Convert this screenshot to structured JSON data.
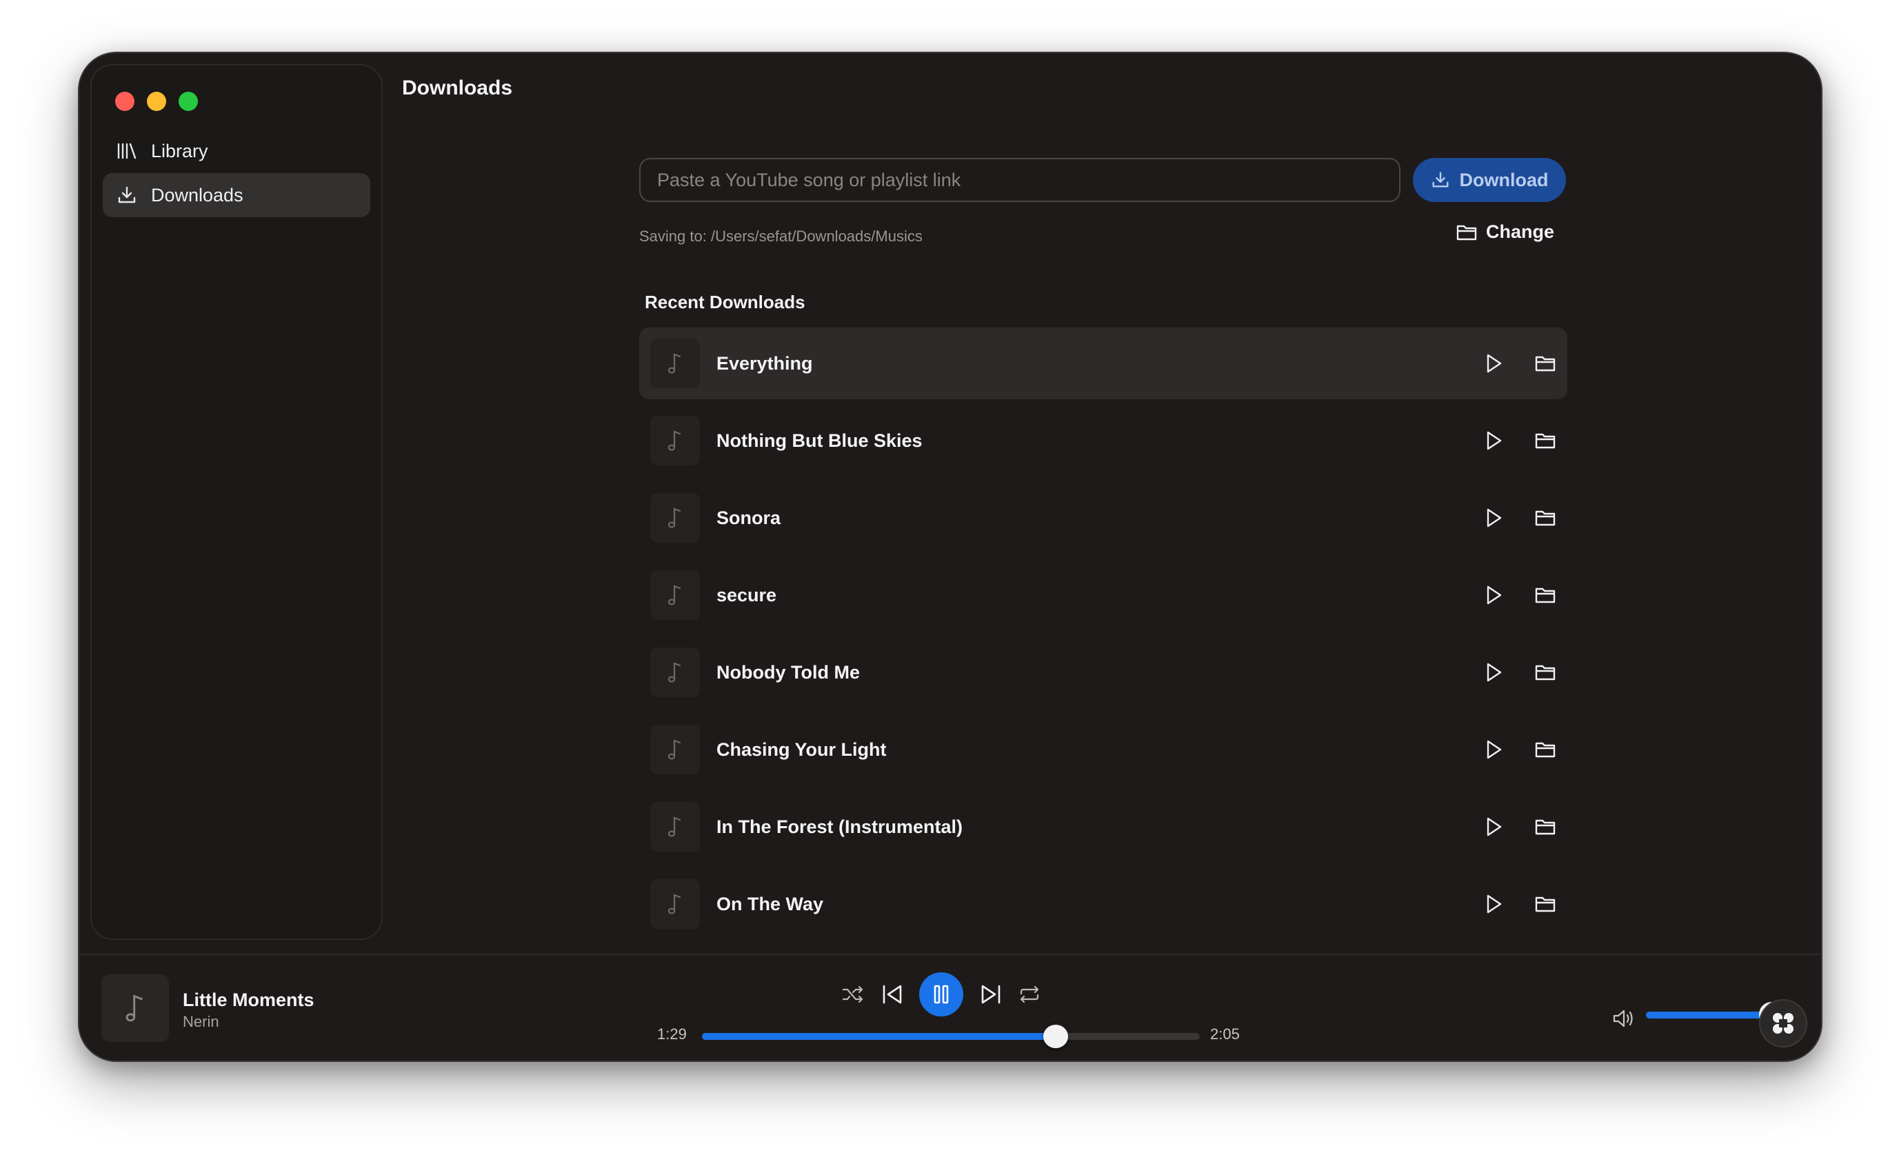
{
  "window": {
    "traffic_lights": [
      "#ff5f57",
      "#febc2e",
      "#28c840"
    ]
  },
  "sidebar": {
    "items": [
      {
        "label": "Library",
        "icon": "library-icon",
        "active": false
      },
      {
        "label": "Downloads",
        "icon": "download-icon",
        "active": true
      }
    ]
  },
  "page": {
    "title": "Downloads"
  },
  "download_form": {
    "url_value": "",
    "url_placeholder": "Paste a YouTube song or playlist link",
    "download_label": "Download",
    "saving_to": "Saving to: /Users/sefat/Downloads/Musics",
    "change_label": "Change"
  },
  "recent": {
    "title": "Recent Downloads",
    "items": [
      {
        "title": "Everything"
      },
      {
        "title": "Nothing But Blue Skies"
      },
      {
        "title": "Sonora"
      },
      {
        "title": "secure"
      },
      {
        "title": "Nobody Told Me"
      },
      {
        "title": "Chasing Your Light"
      },
      {
        "title": "In The Forest (Instrumental)"
      },
      {
        "title": "On The Way"
      }
    ]
  },
  "player": {
    "title": "Little Moments",
    "artist": "Nerin",
    "elapsed": "1:29",
    "duration": "2:05",
    "progress": 0.71,
    "volume": 0.95,
    "state": "playing"
  },
  "colors": {
    "accent": "#1a73e8",
    "download_button": "#1c4b99",
    "background": "#1e1a1a",
    "row_highlight": "#2e2a2a"
  }
}
